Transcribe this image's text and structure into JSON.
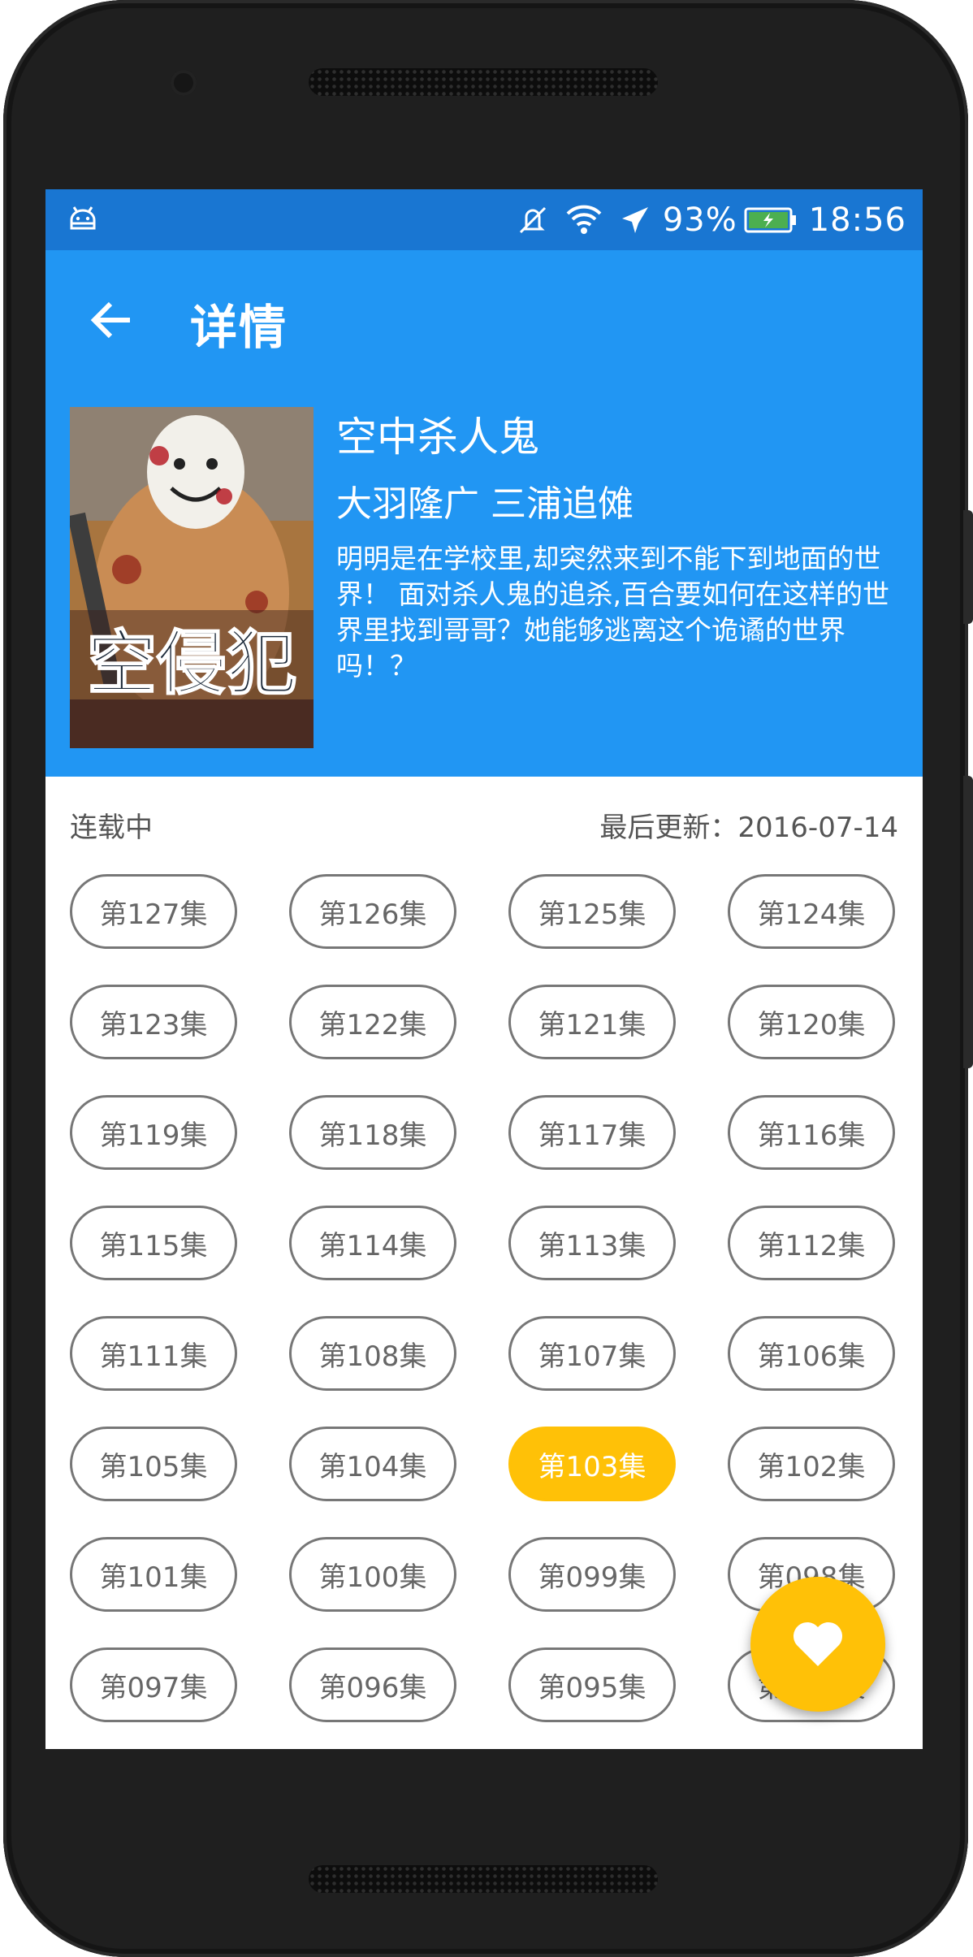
{
  "status_bar": {
    "battery_percent": "93%",
    "time": "18:56"
  },
  "app_bar": {
    "title": "详情"
  },
  "book": {
    "title": "空中杀人鬼",
    "author": "大羽隆广 三浦追傩",
    "description": "明明是在学校里,却突然来到不能下到地面的世界！ 面对杀人鬼的追杀,百合要如何在这样的世界里找到哥哥？她能够逃离这个诡谲的世界吗！？"
  },
  "meta": {
    "status": "连载中",
    "last_update": "最后更新：2016-07-14"
  },
  "chapters": [
    {
      "label": "第127集",
      "selected": false
    },
    {
      "label": "第126集",
      "selected": false
    },
    {
      "label": "第125集",
      "selected": false
    },
    {
      "label": "第124集",
      "selected": false
    },
    {
      "label": "第123集",
      "selected": false
    },
    {
      "label": "第122集",
      "selected": false
    },
    {
      "label": "第121集",
      "selected": false
    },
    {
      "label": "第120集",
      "selected": false
    },
    {
      "label": "第119集",
      "selected": false
    },
    {
      "label": "第118集",
      "selected": false
    },
    {
      "label": "第117集",
      "selected": false
    },
    {
      "label": "第116集",
      "selected": false
    },
    {
      "label": "第115集",
      "selected": false
    },
    {
      "label": "第114集",
      "selected": false
    },
    {
      "label": "第113集",
      "selected": false
    },
    {
      "label": "第112集",
      "selected": false
    },
    {
      "label": "第111集",
      "selected": false
    },
    {
      "label": "第108集",
      "selected": false
    },
    {
      "label": "第107集",
      "selected": false
    },
    {
      "label": "第106集",
      "selected": false
    },
    {
      "label": "第105集",
      "selected": false
    },
    {
      "label": "第104集",
      "selected": false
    },
    {
      "label": "第103集",
      "selected": true
    },
    {
      "label": "第102集",
      "selected": false
    },
    {
      "label": "第101集",
      "selected": false
    },
    {
      "label": "第100集",
      "selected": false
    },
    {
      "label": "第099集",
      "selected": false
    },
    {
      "label": "第098集",
      "selected": false
    },
    {
      "label": "第097集",
      "selected": false
    },
    {
      "label": "第096集",
      "selected": false
    },
    {
      "label": "第095集",
      "selected": false
    },
    {
      "label": "第094集",
      "selected": false
    }
  ],
  "fab": {
    "icon": "heart-icon"
  },
  "colors": {
    "primary": "#2196F3",
    "primary_dark": "#1976D2",
    "accent": "#FFC107"
  }
}
